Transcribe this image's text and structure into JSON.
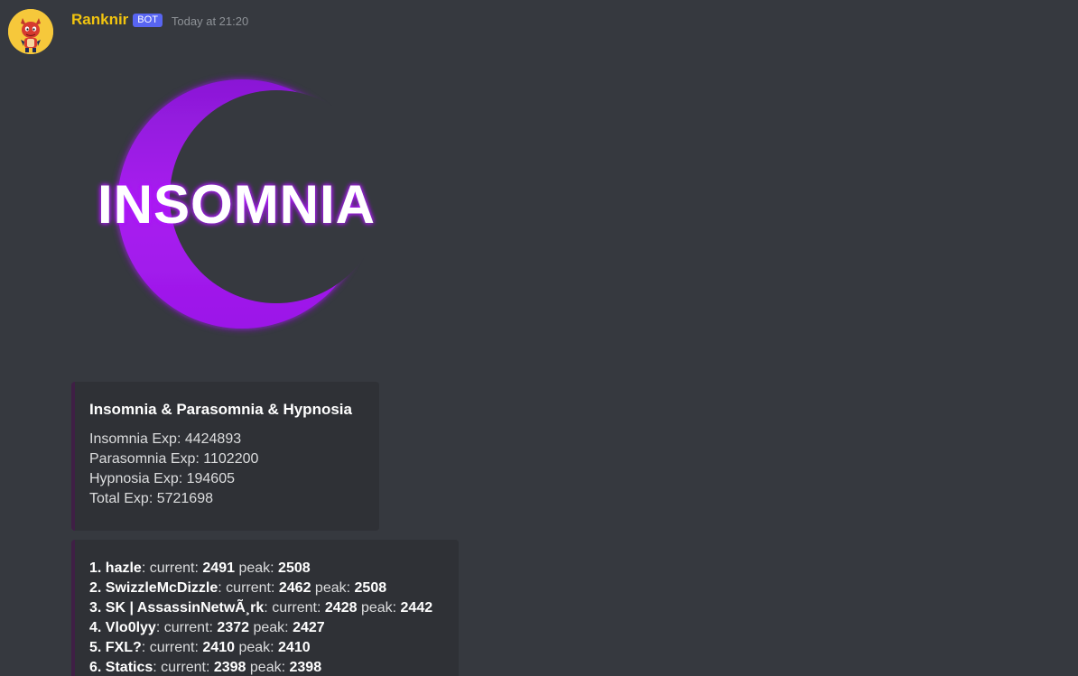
{
  "author": {
    "username": "Ranknir",
    "tag": "BOT",
    "timestamp": "Today at 21:20"
  },
  "banner": {
    "logo_text": "INSOMNIA"
  },
  "stats_embed": {
    "title": "Insomnia & Parasomnia & Hypnosia",
    "lines": [
      "Insomnia Exp: 4424893",
      "Parasomnia Exp: 1102200",
      "Hypnosia Exp: 194605",
      "Total Exp: 5721698"
    ]
  },
  "ranking_embed": {
    "current_label": "current:",
    "peak_label": "peak:",
    "rows": [
      {
        "rank": "1.",
        "name": "hazle",
        "current": "2491",
        "peak": "2508"
      },
      {
        "rank": "2.",
        "name": "SwizzleMcDizzle",
        "current": "2462",
        "peak": "2508"
      },
      {
        "rank": "3.",
        "name": "SK | AssassinNetwÃ¸rk",
        "current": "2428",
        "peak": "2442"
      },
      {
        "rank": "4.",
        "name": "Vlo0lyy",
        "current": "2372",
        "peak": "2427"
      },
      {
        "rank": "5.",
        "name": "FXL?",
        "current": "2410",
        "peak": "2410"
      },
      {
        "rank": "6.",
        "name": "Statics",
        "current": "2398",
        "peak": "2398"
      }
    ]
  },
  "colors": {
    "background": "#36393f",
    "embed_background": "#2f3136",
    "embed_accent": "#3f1f45",
    "username": "#f1c40f",
    "bot_tag": "#5865f2",
    "crescent": "#9b16e8"
  }
}
